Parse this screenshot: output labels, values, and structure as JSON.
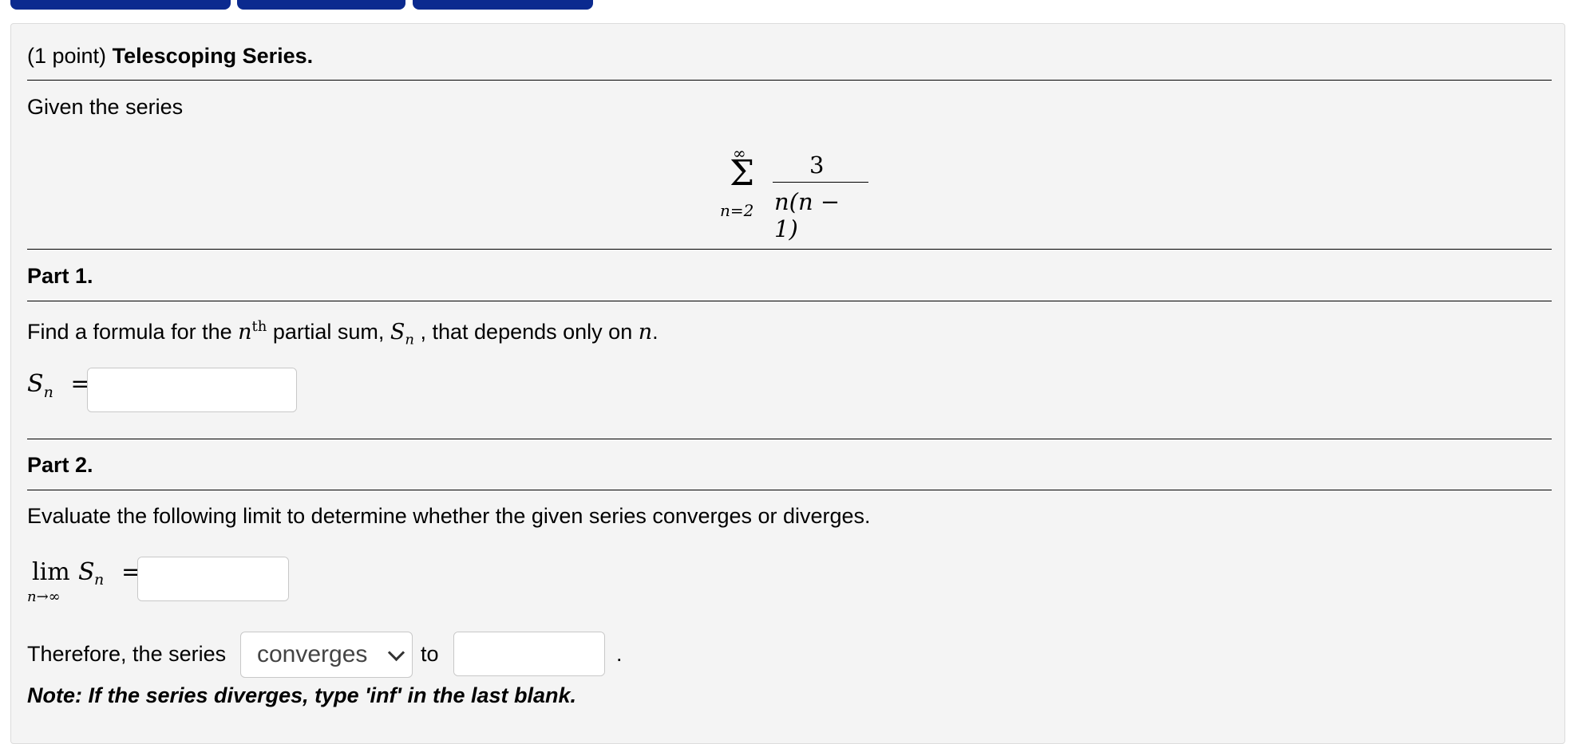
{
  "problem": {
    "points": "(1 point)",
    "title": "Telescoping Series.",
    "given_text": "Given the series",
    "series": {
      "sigma": "Σ",
      "upper": "∞",
      "lower": "n=2",
      "numerator": "3",
      "denominator": "n(n − 1)"
    }
  },
  "part1": {
    "heading": "Part 1.",
    "instruction": {
      "pre": "Find a formula for the ",
      "n": "n",
      "th": "th",
      "mid": " partial sum, ",
      "S": "S",
      "sub": "n",
      "post": " , that depends only on ",
      "n_end": "n",
      "period": "."
    },
    "answer_label": {
      "S": "S",
      "sub": "n",
      "eq": "="
    },
    "answer_value": ""
  },
  "part2": {
    "heading": "Part 2.",
    "instruction": "Evaluate the following limit to determine whether the given series converges or diverges.",
    "limit_label": {
      "lim": "lim",
      "under": "n→∞",
      "S": "S",
      "sub": "n",
      "eq": "="
    },
    "limit_value": "",
    "therefore_text": "Therefore, the series",
    "select_value": "converges",
    "to_text": "to",
    "final_value": "",
    "period": ".",
    "note": "Note: If the series diverges, type 'inf' in the last blank."
  },
  "colors": {
    "tab": "#0b2a8f",
    "card": "#f4f4f4"
  },
  "icons": {
    "palette": "grid-icon"
  }
}
